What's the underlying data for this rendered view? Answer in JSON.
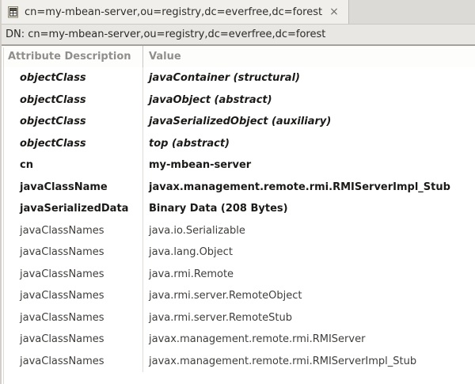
{
  "tab": {
    "icon": "entry-table-icon",
    "label": "cn=my-mbean-server,ou=registry,dc=everfree,dc=forest",
    "close_glyph": "×"
  },
  "dn_bar": {
    "text": "DN: cn=my-mbean-server,ou=registry,dc=everfree,dc=forest"
  },
  "table": {
    "columns": [
      "Attribute Description",
      "Value"
    ],
    "rows": [
      {
        "attribute": "objectClass",
        "value": "javaContainer (structural)",
        "style": "objectclass"
      },
      {
        "attribute": "objectClass",
        "value": "javaObject (abstract)",
        "style": "objectclass"
      },
      {
        "attribute": "objectClass",
        "value": "javaSerializedObject (auxiliary)",
        "style": "objectclass"
      },
      {
        "attribute": "objectClass",
        "value": "top (abstract)",
        "style": "objectclass"
      },
      {
        "attribute": "cn",
        "value": "my-mbean-server",
        "style": "must"
      },
      {
        "attribute": "javaClassName",
        "value": "javax.management.remote.rmi.RMIServerImpl_Stub",
        "style": "must"
      },
      {
        "attribute": "javaSerializedData",
        "value": "Binary Data (208 Bytes)",
        "style": "must"
      },
      {
        "attribute": "javaClassNames",
        "value": "java.io.Serializable",
        "style": "may"
      },
      {
        "attribute": "javaClassNames",
        "value": "java.lang.Object",
        "style": "may"
      },
      {
        "attribute": "javaClassNames",
        "value": "java.rmi.Remote",
        "style": "may"
      },
      {
        "attribute": "javaClassNames",
        "value": "java.rmi.server.RemoteObject",
        "style": "may"
      },
      {
        "attribute": "javaClassNames",
        "value": "java.rmi.server.RemoteStub",
        "style": "may"
      },
      {
        "attribute": "javaClassNames",
        "value": "javax.management.remote.rmi.RMIServer",
        "style": "may"
      },
      {
        "attribute": "javaClassNames",
        "value": "javax.management.remote.rmi.RMIServerImpl_Stub",
        "style": "may"
      }
    ]
  },
  "colors": {
    "tab_bar_bg": "#dcdad7",
    "active_tab_bg": "#f0efec",
    "dn_bar_bg": "#e9e7e4",
    "dn_border": "#a5a29e",
    "header_text": "#918f8c",
    "bold_row_text": "#1b1a18",
    "regular_row_text": "#3f3e3c"
  }
}
